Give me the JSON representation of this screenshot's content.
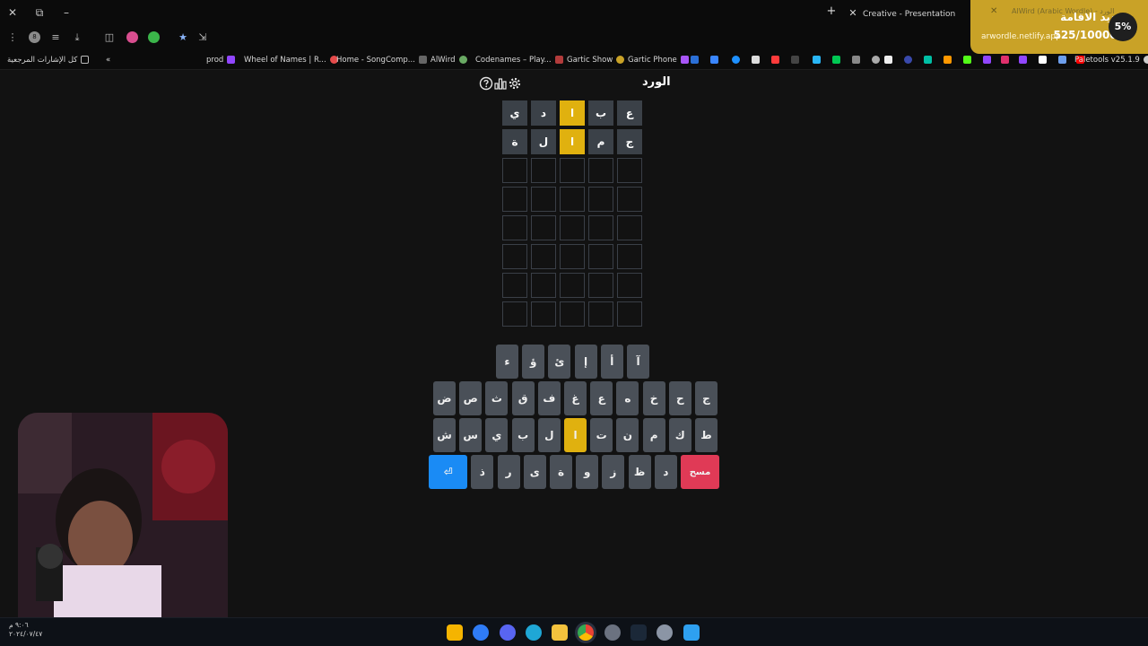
{
  "browser": {
    "tabs": [
      {
        "title": "Creative - Presentation"
      },
      {
        "title": "AlWird (Arabic Wordle) - الورد"
      }
    ],
    "bookmarks": [
      {
        "label": "كل الإشارات المرجعية"
      },
      {
        "label": "prod"
      },
      {
        "label": "Wheel of Names | R..."
      },
      {
        "label": "Home - SongComp..."
      },
      {
        "label": "AlWird"
      },
      {
        "label": "Codenames – Play..."
      },
      {
        "label": "Gartic Show"
      },
      {
        "label": "Gartic Phone"
      },
      {
        "label": "Paletools v25.1.9"
      }
    ],
    "profile_initial": "8"
  },
  "notification": {
    "title": "تجديد الاقامة",
    "url": "arwordle.netlify.app",
    "progress_text": "525/10000$",
    "percent": "5%"
  },
  "game": {
    "title": "الورد",
    "icons": {
      "help": "help-icon",
      "stats": "stats-icon",
      "settings": "gear-icon"
    },
    "board": [
      [
        {
          "l": "ع",
          "s": "absent"
        },
        {
          "l": "ب",
          "s": "absent"
        },
        {
          "l": "ا",
          "s": "present"
        },
        {
          "l": "د",
          "s": "absent"
        },
        {
          "l": "ي",
          "s": "absent"
        }
      ],
      [
        {
          "l": "ج",
          "s": "absent"
        },
        {
          "l": "م",
          "s": "absent"
        },
        {
          "l": "ا",
          "s": "present"
        },
        {
          "l": "ل",
          "s": "absent"
        },
        {
          "l": "ة",
          "s": "absent"
        }
      ],
      [
        {
          "l": "",
          "s": "empty"
        },
        {
          "l": "",
          "s": "empty"
        },
        {
          "l": "",
          "s": "empty"
        },
        {
          "l": "",
          "s": "empty"
        },
        {
          "l": "",
          "s": "empty"
        }
      ],
      [
        {
          "l": "",
          "s": "empty"
        },
        {
          "l": "",
          "s": "empty"
        },
        {
          "l": "",
          "s": "empty"
        },
        {
          "l": "",
          "s": "empty"
        },
        {
          "l": "",
          "s": "empty"
        }
      ],
      [
        {
          "l": "",
          "s": "empty"
        },
        {
          "l": "",
          "s": "empty"
        },
        {
          "l": "",
          "s": "empty"
        },
        {
          "l": "",
          "s": "empty"
        },
        {
          "l": "",
          "s": "empty"
        }
      ],
      [
        {
          "l": "",
          "s": "empty"
        },
        {
          "l": "",
          "s": "empty"
        },
        {
          "l": "",
          "s": "empty"
        },
        {
          "l": "",
          "s": "empty"
        },
        {
          "l": "",
          "s": "empty"
        }
      ],
      [
        {
          "l": "",
          "s": "empty"
        },
        {
          "l": "",
          "s": "empty"
        },
        {
          "l": "",
          "s": "empty"
        },
        {
          "l": "",
          "s": "empty"
        },
        {
          "l": "",
          "s": "empty"
        }
      ],
      [
        {
          "l": "",
          "s": "empty"
        },
        {
          "l": "",
          "s": "empty"
        },
        {
          "l": "",
          "s": "empty"
        },
        {
          "l": "",
          "s": "empty"
        },
        {
          "l": "",
          "s": "empty"
        }
      ]
    ],
    "keyboard": {
      "row1": [
        {
          "k": "آ",
          "s": "normal"
        },
        {
          "k": "أ",
          "s": "normal"
        },
        {
          "k": "إ",
          "s": "normal"
        },
        {
          "k": "ئ",
          "s": "normal"
        },
        {
          "k": "ؤ",
          "s": "normal"
        },
        {
          "k": "ء",
          "s": "normal"
        }
      ],
      "row2": [
        {
          "k": "ج",
          "s": "normal"
        },
        {
          "k": "ح",
          "s": "normal"
        },
        {
          "k": "خ",
          "s": "normal"
        },
        {
          "k": "ه",
          "s": "normal"
        },
        {
          "k": "ع",
          "s": "normal"
        },
        {
          "k": "غ",
          "s": "normal"
        },
        {
          "k": "ف",
          "s": "normal"
        },
        {
          "k": "ق",
          "s": "normal"
        },
        {
          "k": "ث",
          "s": "normal"
        },
        {
          "k": "ص",
          "s": "normal"
        },
        {
          "k": "ض",
          "s": "normal"
        }
      ],
      "row3": [
        {
          "k": "ط",
          "s": "normal"
        },
        {
          "k": "ك",
          "s": "normal"
        },
        {
          "k": "م",
          "s": "normal"
        },
        {
          "k": "ن",
          "s": "normal"
        },
        {
          "k": "ت",
          "s": "normal"
        },
        {
          "k": "ا",
          "s": "present"
        },
        {
          "k": "ل",
          "s": "normal"
        },
        {
          "k": "ب",
          "s": "normal"
        },
        {
          "k": "ي",
          "s": "normal"
        },
        {
          "k": "س",
          "s": "normal"
        },
        {
          "k": "ش",
          "s": "normal"
        }
      ],
      "row4": [
        {
          "k": "مسح",
          "s": "delete"
        },
        {
          "k": "د",
          "s": "normal"
        },
        {
          "k": "ظ",
          "s": "normal"
        },
        {
          "k": "ز",
          "s": "normal"
        },
        {
          "k": "و",
          "s": "normal"
        },
        {
          "k": "ة",
          "s": "normal"
        },
        {
          "k": "ى",
          "s": "normal"
        },
        {
          "k": "ر",
          "s": "normal"
        },
        {
          "k": "ذ",
          "s": "normal"
        },
        {
          "k": "⏎",
          "s": "enter"
        }
      ]
    },
    "colors": {
      "present": "#e0b10f",
      "absent": "#3b4148",
      "enter": "#1a8bf5",
      "delete": "#e03a56",
      "background": "#121212"
    }
  },
  "taskbar": {
    "clock_time": "٩:٠٦ م",
    "clock_date": "٢٠٢٤/٠٧/٤٧",
    "apps": [
      "rockstar-icon",
      "copilot-icon",
      "discord-icon",
      "edge-icon",
      "file-explorer-icon",
      "chrome-icon",
      "app-icon",
      "steam-icon",
      "settings-icon",
      "windows-start-icon"
    ]
  },
  "webcam": {
    "label": "streamer-webcam"
  }
}
